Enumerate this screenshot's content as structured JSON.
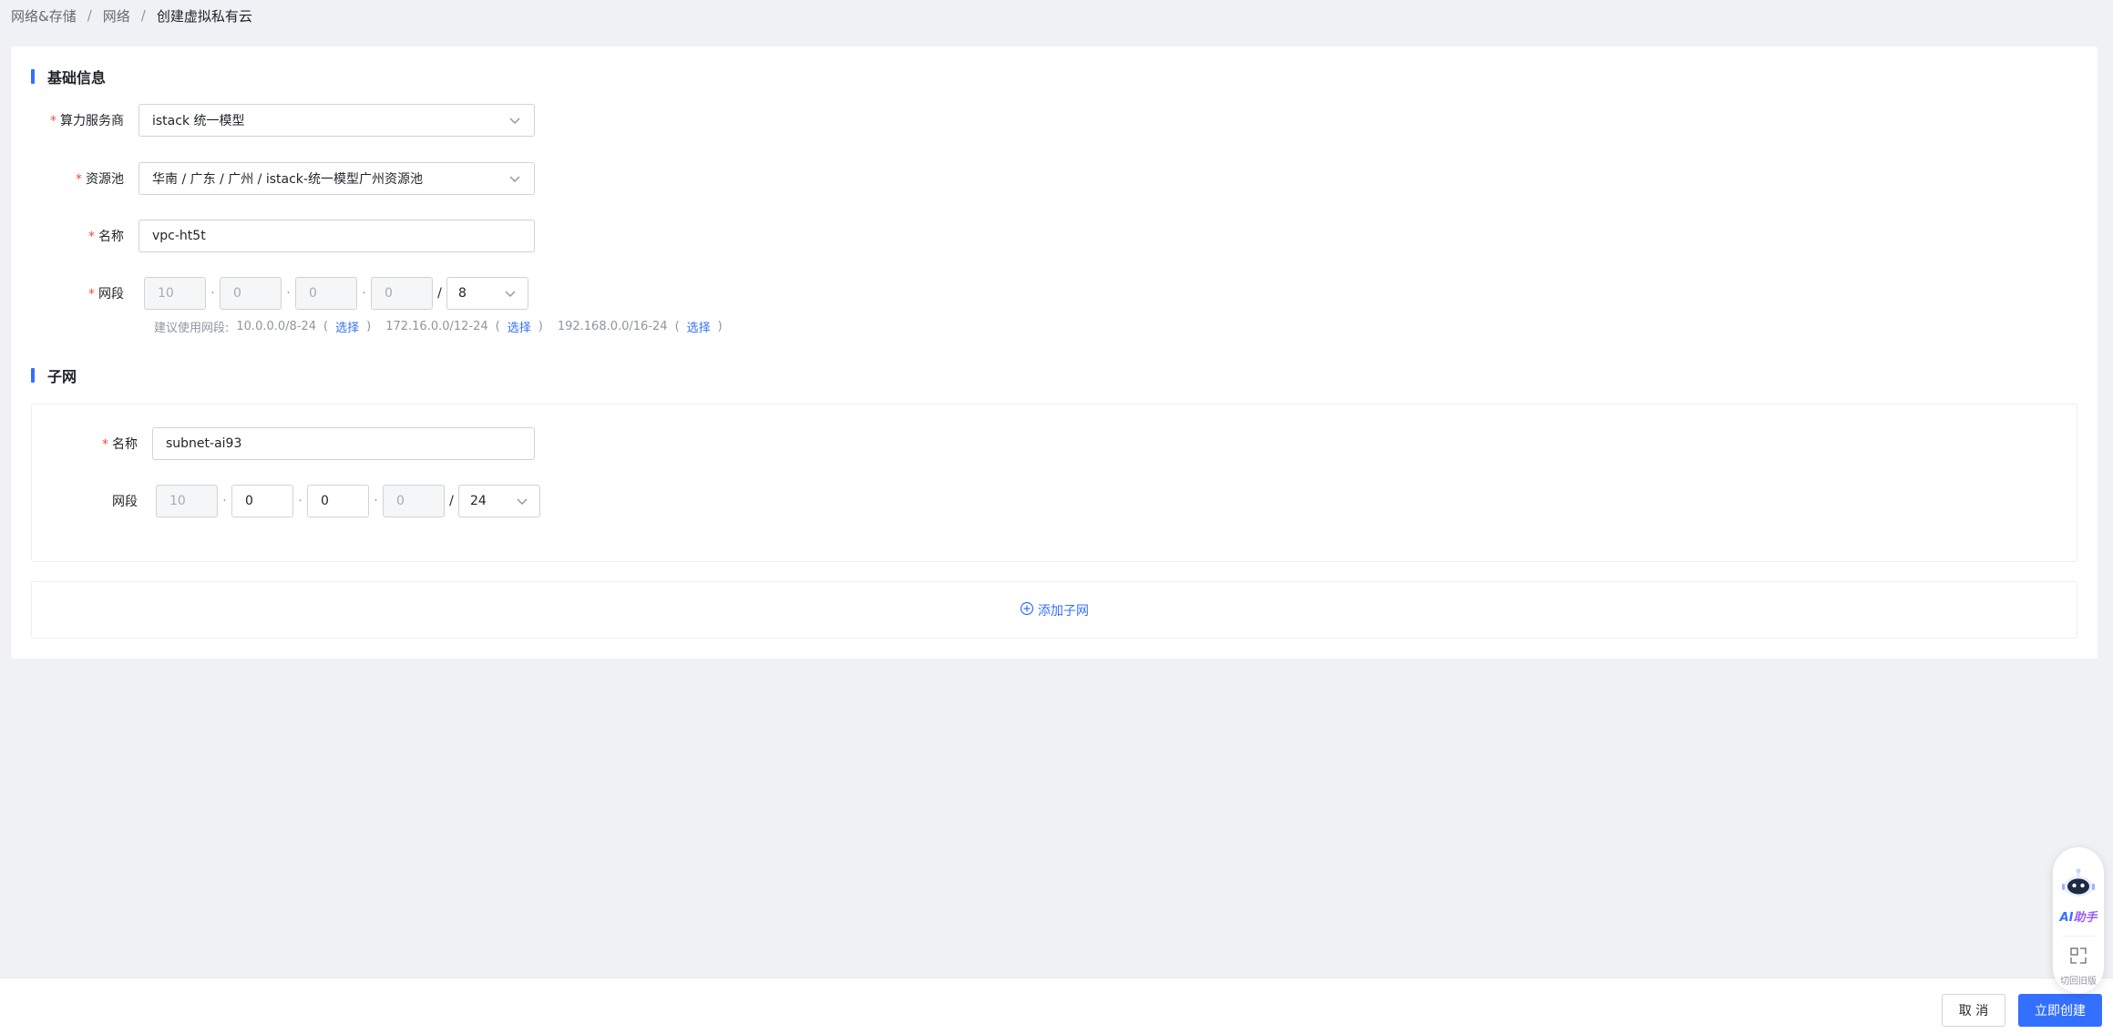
{
  "breadcrumb": {
    "items": [
      "网络&存储",
      "网络"
    ],
    "separator": "/",
    "current": "创建虚拟私有云"
  },
  "basic": {
    "title": "基础信息",
    "provider": {
      "label": "算力服务商",
      "value": "istack 统一模型"
    },
    "pool": {
      "label": "资源池",
      "value": "华南 / 广东 / 广州 / istack-统一模型广州资源池"
    },
    "name": {
      "label": "名称",
      "value": "vpc-ht5t"
    },
    "cidr": {
      "label": "网段",
      "octets": [
        "10",
        "0",
        "0",
        "0"
      ],
      "mask": "8"
    },
    "hint": {
      "prefix": "建议使用网段:",
      "segments": [
        "10.0.0.0/8-24",
        "172.16.0.0/12-24",
        "192.168.0.0/16-24"
      ],
      "open": "(",
      "close": ")",
      "link": "选择"
    }
  },
  "subnet": {
    "title": "子网",
    "name": {
      "label": "名称",
      "value": "subnet-ai93"
    },
    "cidr": {
      "label": "网段",
      "octets": [
        "10",
        "0",
        "0",
        "0"
      ],
      "mask": "24"
    },
    "add_label": "添加子网"
  },
  "required_mark": "*",
  "footer": {
    "cancel": "取 消",
    "submit": "立即创建"
  },
  "float": {
    "ai_label_a": "AI",
    "ai_label_b": "助手",
    "switch_label": "切回旧版"
  },
  "colors": {
    "accent": "#3370ff",
    "required": "#f54a45",
    "background": "#eff1f5"
  }
}
